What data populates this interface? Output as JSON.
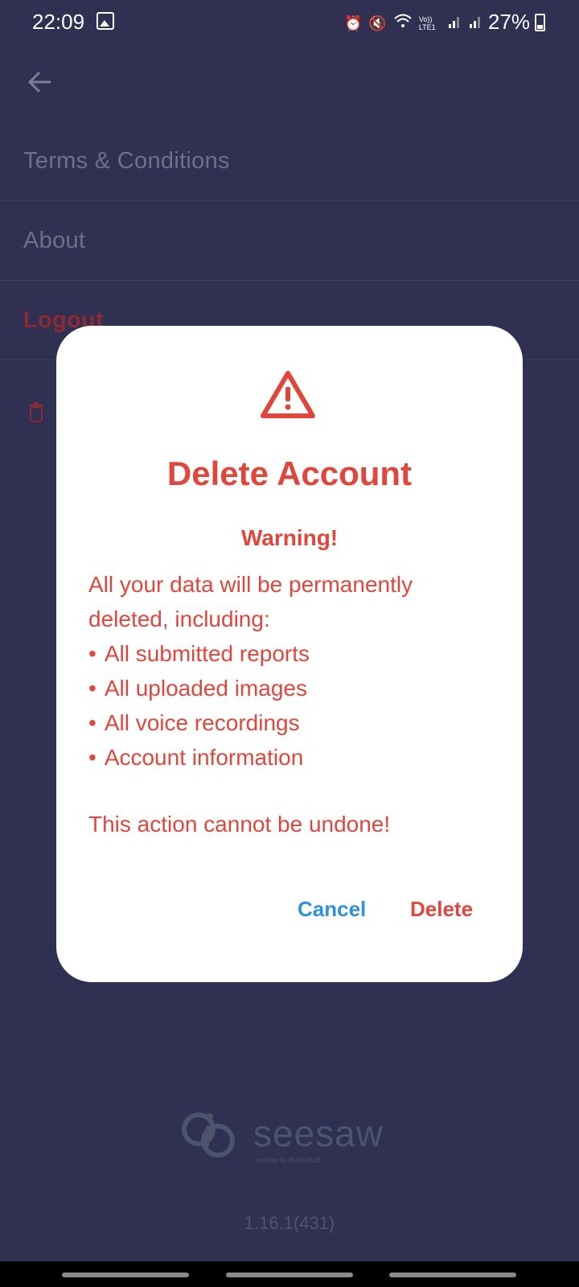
{
  "status_bar": {
    "time": "22:09",
    "network_label": "Vo)) LTE1",
    "battery": "27%"
  },
  "menu": {
    "terms": "Terms & Conditions",
    "about": "About",
    "logout": "Logout"
  },
  "dialog": {
    "title": "Delete Account",
    "warning": "Warning!",
    "intro_line1": "All your data will be permanently",
    "intro_line2": "deleted, including:",
    "items": [
      "All submitted reports",
      "All uploaded images",
      "All voice recordings",
      "Account information"
    ],
    "final_text": "This action cannot be undone!",
    "cancel_label": "Cancel",
    "delete_label": "Delete"
  },
  "footer": {
    "logo_text": "seesaw",
    "logo_sub": "Invisible by PLAYABLE",
    "version": "1.16.1(431)"
  },
  "colors": {
    "background": "#2f3052",
    "danger": "#e0463c",
    "cancel": "#2f8fe0",
    "dialog_bg": "#ffffff"
  }
}
